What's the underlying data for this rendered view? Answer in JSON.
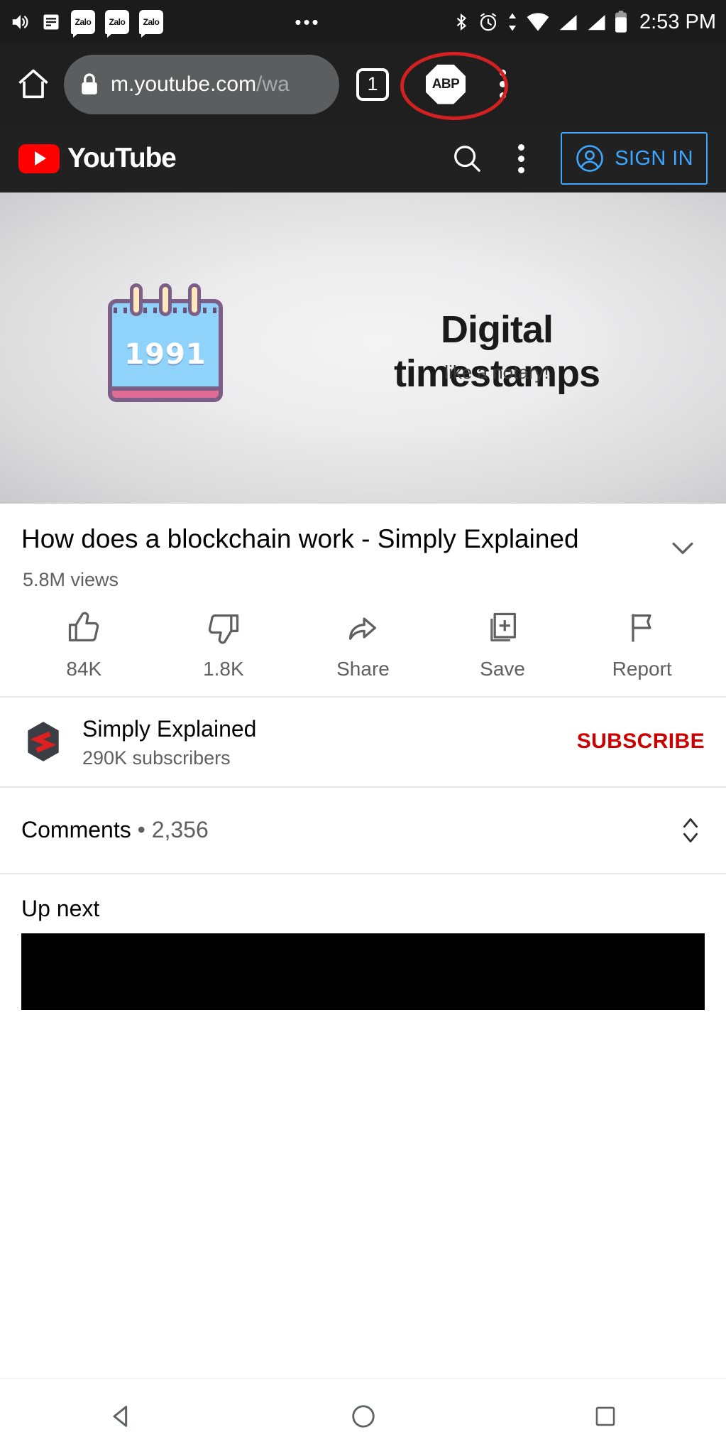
{
  "statusbar": {
    "time": "2:53 PM",
    "left_icons": [
      "volume-icon",
      "notification-icon"
    ],
    "app_badges": [
      "Zalo",
      "Zalo",
      "Zalo"
    ],
    "overflow": "•••",
    "right_icons": [
      "bluetooth-icon",
      "alarm-icon",
      "sync-icon",
      "wifi-icon",
      "signal-icon",
      "signal-icon",
      "battery-icon"
    ]
  },
  "browser": {
    "home_icon": "home-icon",
    "lock_icon": "lock-icon",
    "url_host": "m.youtube.com",
    "url_path": "/wa",
    "tab_count": "1",
    "adblock_label": "ABP",
    "annotation_color": "#d32020",
    "menu_icon": "kebab-menu-icon"
  },
  "ytheader": {
    "brand": "YouTube",
    "search_icon": "search-icon",
    "menu_icon": "kebab-menu-icon",
    "signin_label": "SIGN IN",
    "signin_icon": "account-circle-icon",
    "accent": "#3ea6ff"
  },
  "video": {
    "calendar_year": "1991",
    "headline": "Digital timestamps",
    "subhead": "like a notary!"
  },
  "details": {
    "title": "How does a blockchain work - Simply Explained",
    "views": "5.8M views",
    "expand_icon": "chevron-down-icon"
  },
  "actions": [
    {
      "icon": "thumbs-up-icon",
      "label": "84K"
    },
    {
      "icon": "thumbs-down-icon",
      "label": "1.8K"
    },
    {
      "icon": "share-icon",
      "label": "Share"
    },
    {
      "icon": "save-icon",
      "label": "Save"
    },
    {
      "icon": "flag-icon",
      "label": "Report"
    }
  ],
  "channel": {
    "name": "Simply Explained",
    "subscribers": "290K subscribers",
    "subscribe_label": "SUBSCRIBE",
    "subscribe_color": "#cc0000",
    "avatar_icon": "channel-avatar"
  },
  "comments": {
    "label": "Comments",
    "separator": "•",
    "count": "2,356",
    "sort_icon": "sort-chevrons-icon"
  },
  "upnext": {
    "label": "Up next"
  },
  "navbar": {
    "back_icon": "back-triangle-icon",
    "home_icon": "home-circle-icon",
    "recents_icon": "recents-square-icon"
  }
}
